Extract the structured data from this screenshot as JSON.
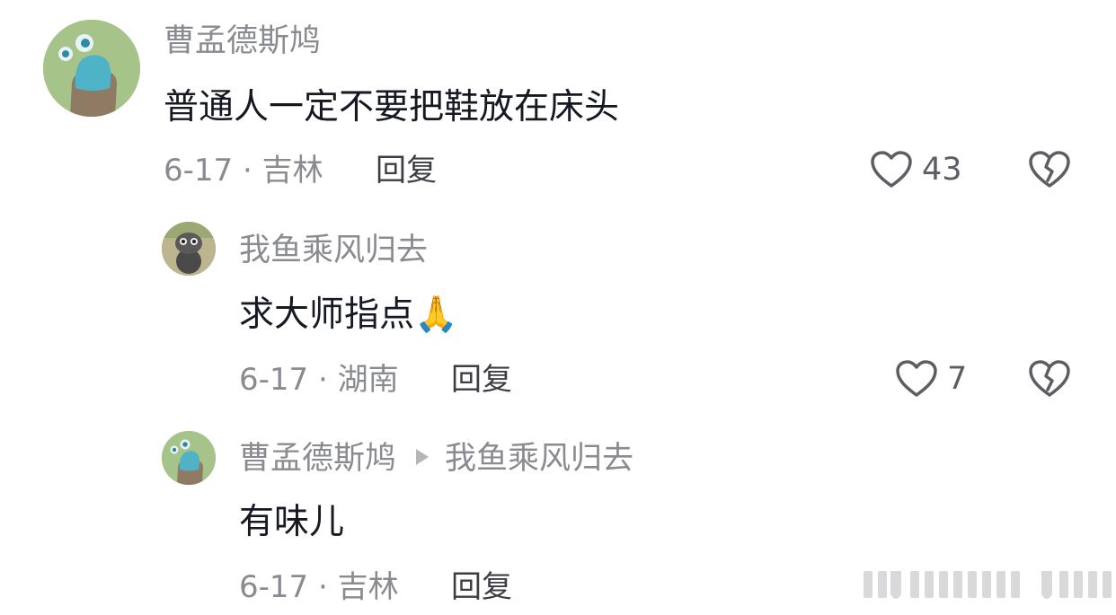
{
  "comments": [
    {
      "username": "曹孟德斯鸠",
      "text": "普通人一定不要把鞋放在床头",
      "meta": "6-17 · 吉林",
      "reply_label": "回复",
      "likes": "43"
    },
    {
      "username": "我鱼乘风归去",
      "text": "求大师指点",
      "emoji": "🙏",
      "meta": "6-17 · 湖南",
      "reply_label": "回复",
      "likes": "7"
    },
    {
      "username": "曹孟德斯鸠",
      "reply_to": "我鱼乘风归去",
      "text": "有味儿",
      "meta": "6-17 · 吉林",
      "reply_label": "回复"
    }
  ],
  "icons": {
    "like": "heart-outline-icon",
    "dislike": "broken-heart-icon",
    "reply_indicator": "play-triangle-icon"
  },
  "colors": {
    "username": "#8a8b91",
    "text": "#161823",
    "meta": "#8a8b91",
    "icon": "#5d5e64"
  }
}
